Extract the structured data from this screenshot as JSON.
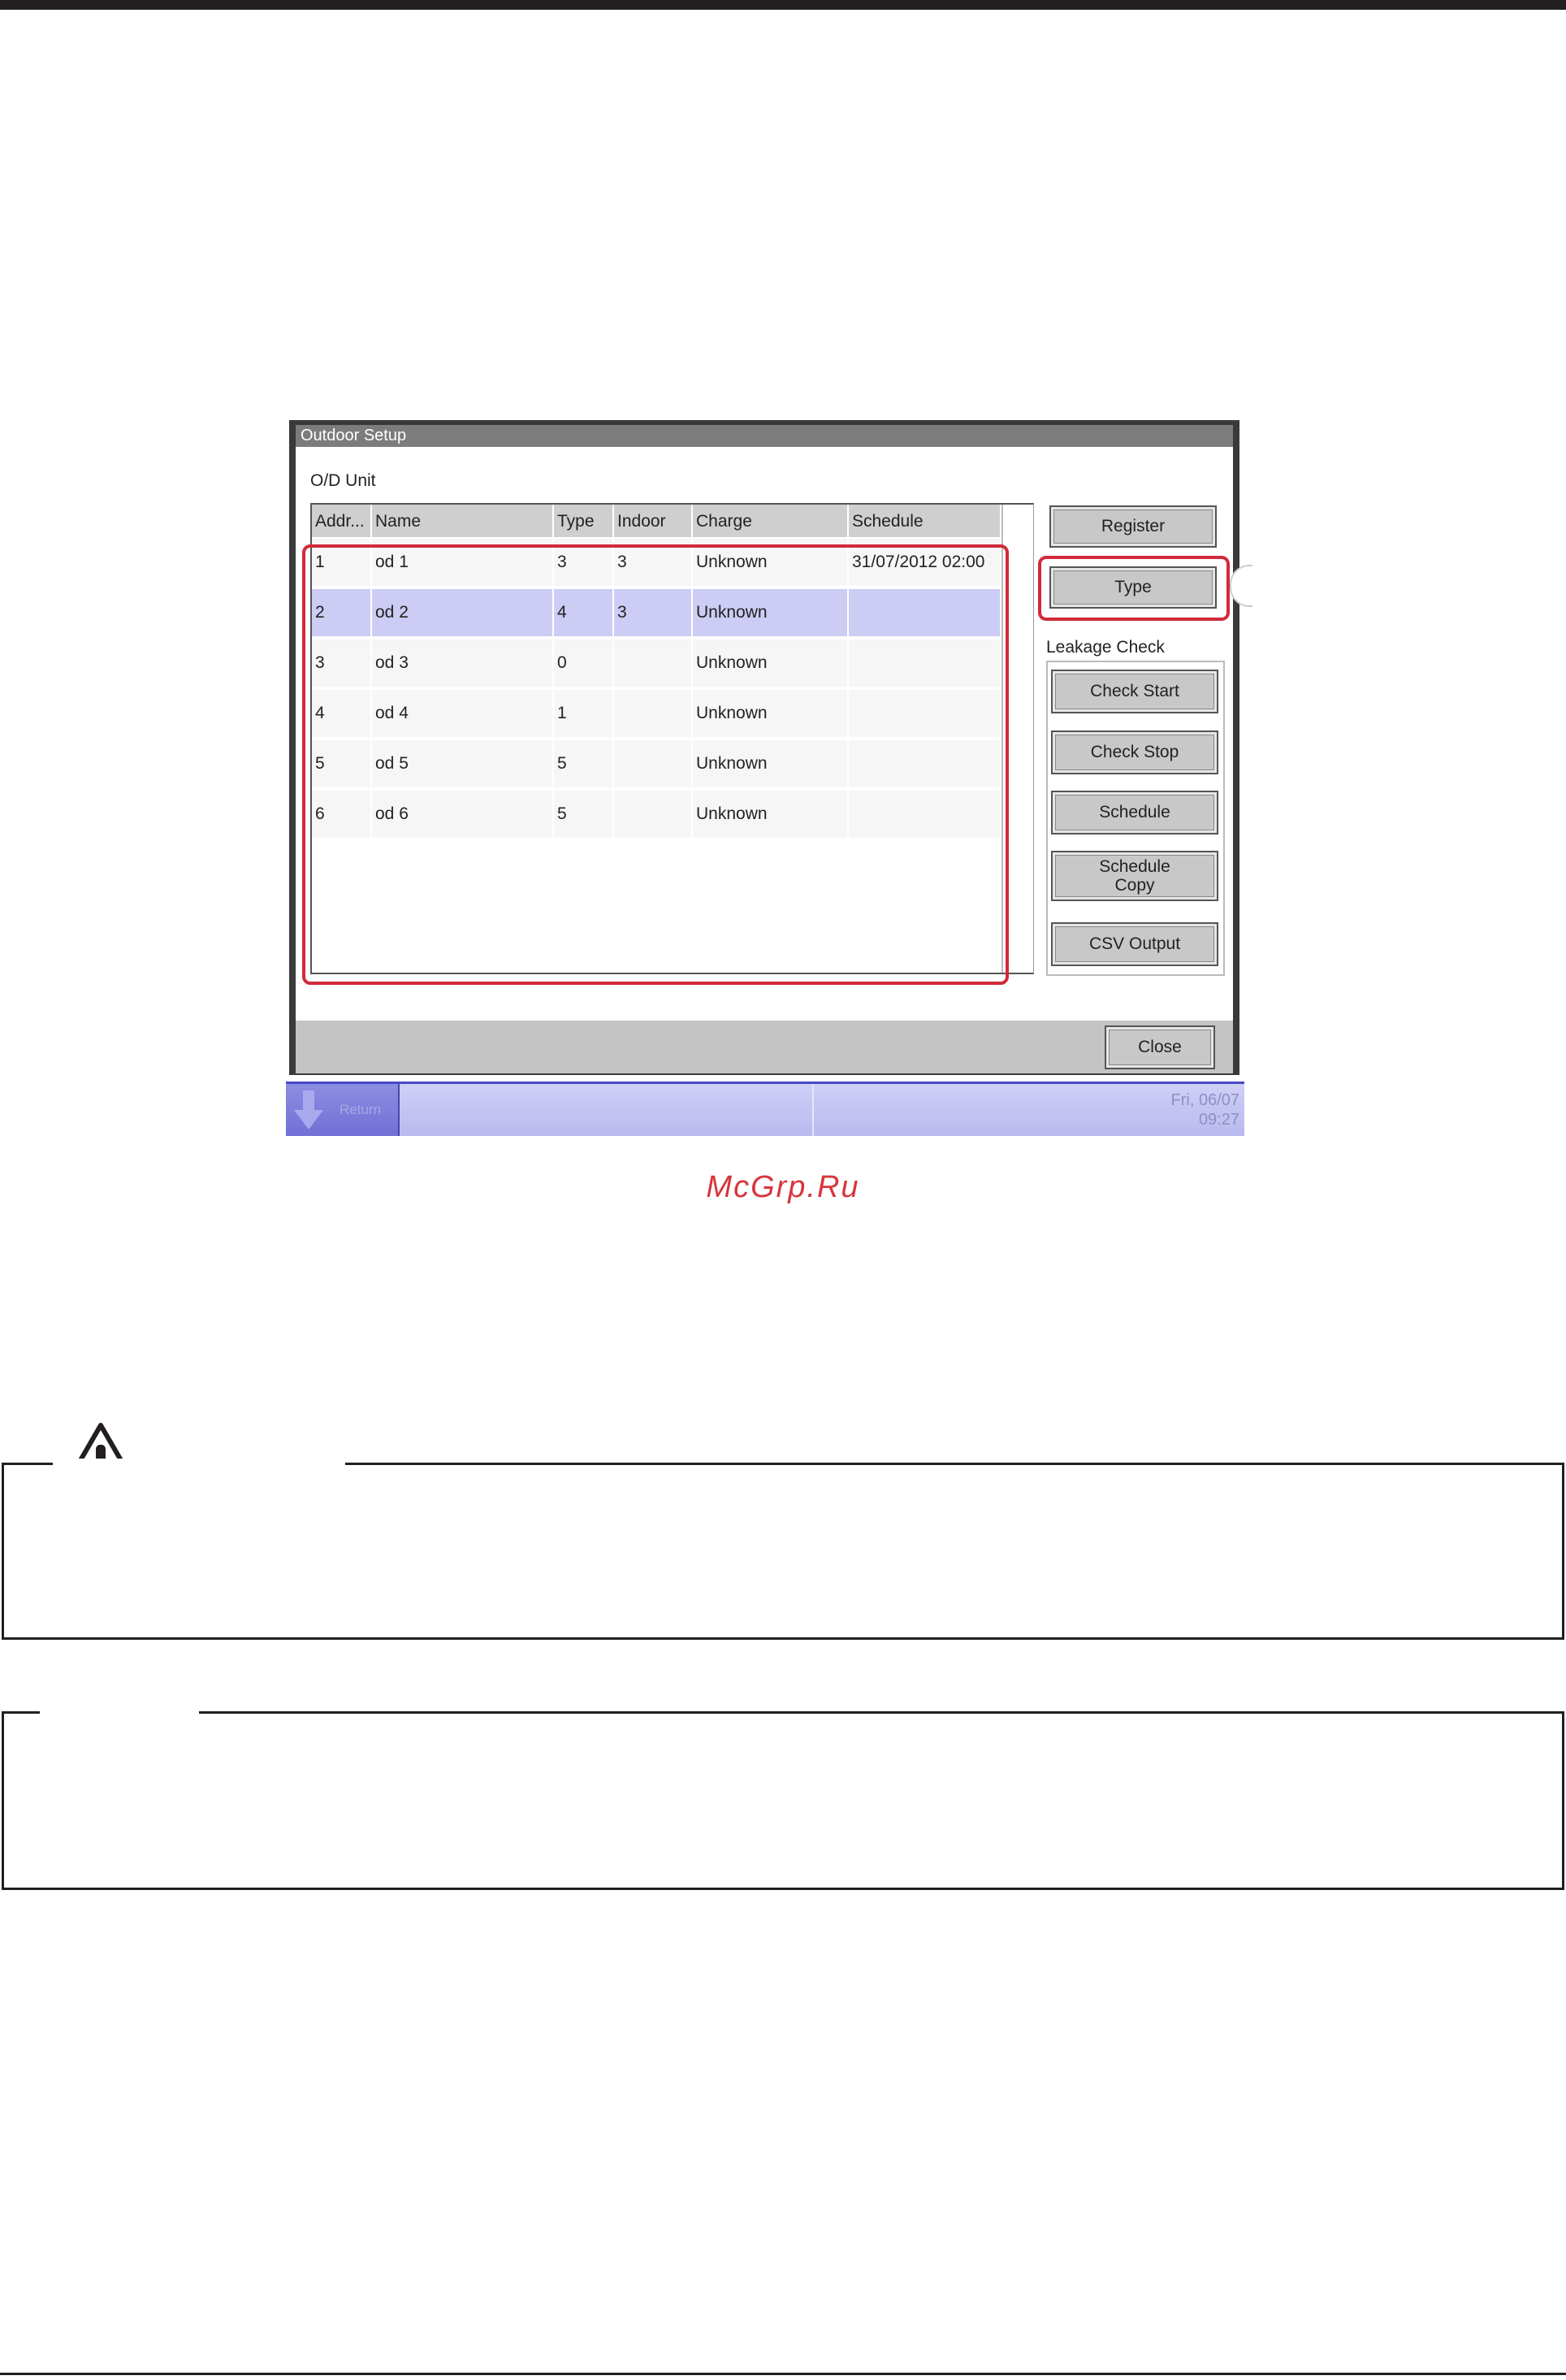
{
  "window": {
    "title": "Outdoor Setup",
    "section_label": "O/D Unit",
    "table": {
      "columns": [
        "Addr...",
        "Name",
        "Type",
        "Indoor",
        "Charge",
        "Schedule"
      ],
      "rows": [
        {
          "addr": "1",
          "name": "od 1",
          "type": "3",
          "indoor": "3",
          "charge": "Unknown",
          "schedule": "31/07/2012 02:00",
          "selected": false
        },
        {
          "addr": "2",
          "name": "od 2",
          "type": "4",
          "indoor": "3",
          "charge": "Unknown",
          "schedule": "",
          "selected": true
        },
        {
          "addr": "3",
          "name": "od 3",
          "type": "0",
          "indoor": "",
          "charge": "Unknown",
          "schedule": "",
          "selected": false
        },
        {
          "addr": "4",
          "name": "od 4",
          "type": "1",
          "indoor": "",
          "charge": "Unknown",
          "schedule": "",
          "selected": false
        },
        {
          "addr": "5",
          "name": "od 5",
          "type": "5",
          "indoor": "",
          "charge": "Unknown",
          "schedule": "",
          "selected": false
        },
        {
          "addr": "6",
          "name": "od 6",
          "type": "5",
          "indoor": "",
          "charge": "Unknown",
          "schedule": "",
          "selected": false
        }
      ]
    },
    "buttons": {
      "register": "Register",
      "type": "Type",
      "check_start": "Check Start",
      "check_stop": "Check Stop",
      "schedule": "Schedule",
      "schedule_copy": "Schedule\nCopy",
      "csv_output": "CSV Output",
      "close": "Close"
    },
    "leakage_check_label": "Leakage Check",
    "highlight_color": "#d22a3a",
    "selected_row_color": "#ccccf5"
  },
  "statusbar": {
    "left_label": "Return",
    "date": "Fri, 06/07",
    "time": "09:27",
    "accent_color": "#4848c8"
  },
  "watermark": "McGrp.Ru",
  "icons": {
    "status_left": "arrow-down-icon",
    "caution": "warning-triangle-icon"
  }
}
